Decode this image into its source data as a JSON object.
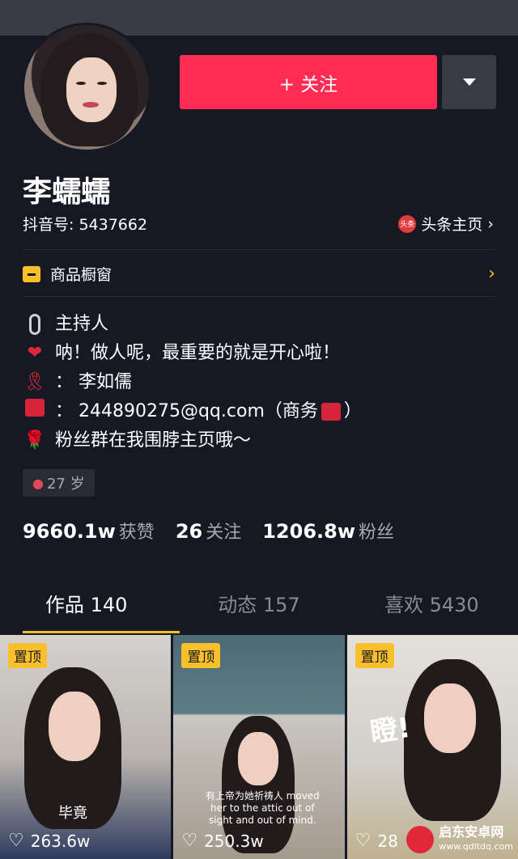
{
  "profile": {
    "name": "李蠕蠕",
    "uid_label": "抖音号: 5437662",
    "toutiao_label": "头条主页",
    "toutiao_logo_text": "头条",
    "follow_label": "+ 关注",
    "shop_label": "商品橱窗",
    "age": "27 岁"
  },
  "bio": {
    "line1": "主持人",
    "line2": "呐！做人呢，最重要的就是开心啦！",
    "line3": "： 李如儒",
    "line4": "： 244890275@qq.com（商务",
    "line4_end": "）",
    "line5": "粉丝群在我围脖主页哦～",
    "heart_icon": "❤",
    "ribbon_icon": "🎗",
    "rose_icon": "🌹"
  },
  "stats": [
    {
      "num": "9660.1w",
      "label": "获赞"
    },
    {
      "num": "26",
      "label": "关注"
    },
    {
      "num": "1206.8w",
      "label": "粉丝"
    }
  ],
  "tabs": [
    {
      "label": "作品 140"
    },
    {
      "label": "动态 157"
    },
    {
      "label": "喜欢 5430"
    }
  ],
  "videos": [
    {
      "pin": "置顶",
      "likes": "263.6w",
      "caption": "毕竟"
    },
    {
      "pin": "置顶",
      "likes": "250.3w",
      "subtitle": "有上帝为她祈祷人 moved her to the attic out of sight and out of mind."
    },
    {
      "pin": "置顶",
      "likes": "28",
      "overlay": "瞪!"
    }
  ],
  "watermark": {
    "name": "启东安卓网",
    "url": "www.qdltdq.com"
  },
  "colors": {
    "background": "#161823",
    "accent": "#fe2c55",
    "highlight": "#f9c02b"
  }
}
